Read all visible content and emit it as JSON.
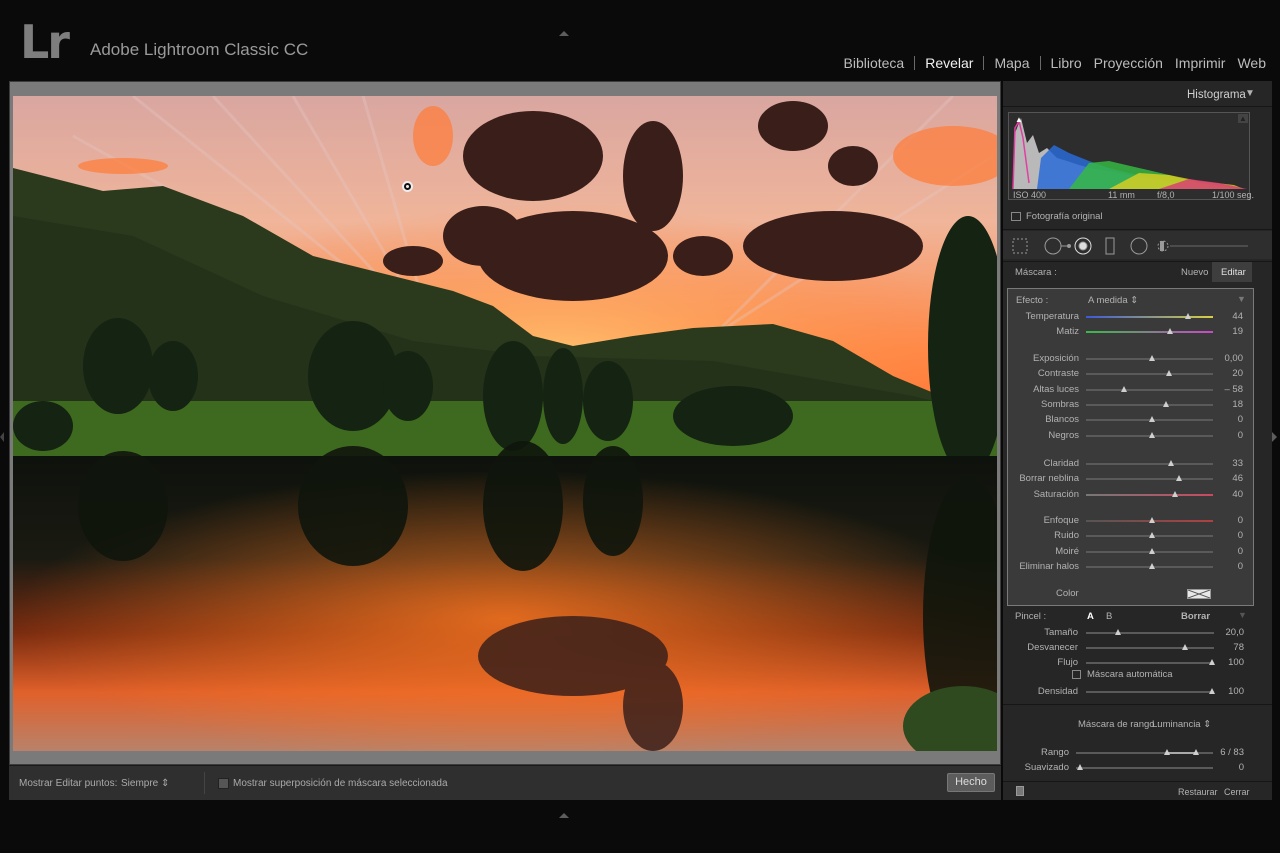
{
  "app": {
    "logo": "Lr",
    "product": "Adobe Lightroom Classic CC",
    "modules": [
      "Biblioteca",
      "Revelar",
      "Mapa",
      "Libro",
      "Proyección",
      "Imprimir",
      "Web"
    ],
    "active_module": "Revelar"
  },
  "histogram": {
    "title": "Histograma",
    "iso": "ISO 400",
    "focal": "11 mm",
    "aperture": "f/8,0",
    "shutter": "1/100 seg.",
    "original_label": "Fotografía original"
  },
  "mask": {
    "label": "Máscara :",
    "new": "Nuevo",
    "edit": "Editar",
    "effect_label": "Efecto :",
    "effect_value": "A medida",
    "groups": [
      [
        {
          "label": "Temperatura",
          "value": "44",
          "pos": 0.8
        },
        {
          "label": "Matiz",
          "value": "19",
          "pos": 0.66
        }
      ],
      [
        {
          "label": "Exposición",
          "value": "0,00",
          "pos": 0.52
        },
        {
          "label": "Contraste",
          "value": "20",
          "pos": 0.65
        },
        {
          "label": "Altas luces",
          "value": "– 58",
          "pos": 0.3
        },
        {
          "label": "Sombras",
          "value": "18",
          "pos": 0.63
        },
        {
          "label": "Blancos",
          "value": "0",
          "pos": 0.52
        },
        {
          "label": "Negros",
          "value": "0",
          "pos": 0.52
        }
      ],
      [
        {
          "label": "Claridad",
          "value": "33",
          "pos": 0.67
        },
        {
          "label": "Borrar neblina",
          "value": "46",
          "pos": 0.73
        },
        {
          "label": "Saturación",
          "value": "40",
          "pos": 0.7
        }
      ],
      [
        {
          "label": "Enfoque",
          "value": "0",
          "pos": 0.52
        },
        {
          "label": "Ruido",
          "value": "0",
          "pos": 0.52
        },
        {
          "label": "Moiré",
          "value": "0",
          "pos": 0.52
        },
        {
          "label": "Eliminar halos",
          "value": "0",
          "pos": 0.52
        }
      ]
    ],
    "color_label": "Color"
  },
  "brush": {
    "label": "Pincel :",
    "a": "A",
    "b": "B",
    "erase": "Borrar",
    "sliders": [
      {
        "label": "Tamaño",
        "value": "20,0",
        "pos": 0.24
      },
      {
        "label": "Desvanecer",
        "value": "78",
        "pos": 0.78
      },
      {
        "label": "Flujo",
        "value": "100",
        "pos": 1.0
      }
    ],
    "auto_mask": "Máscara automática",
    "density_label": "Densidad",
    "density_value": "100",
    "density_pos": 1.0
  },
  "range_mask": {
    "label": "Máscara de rango :",
    "value": "Luminancia",
    "range_label": "Rango",
    "range_value": "6 / 83",
    "smooth_label": "Suavizado",
    "smooth_value": "0"
  },
  "panel_footer": {
    "reset": "Restaurar",
    "close": "Cerrar"
  },
  "toolbar": {
    "show_points_label": "Mostrar Editar puntos:",
    "show_points_value": "Siempre",
    "overlay_label": "Mostrar superposición de máscara seleccionada",
    "done": "Hecho"
  }
}
